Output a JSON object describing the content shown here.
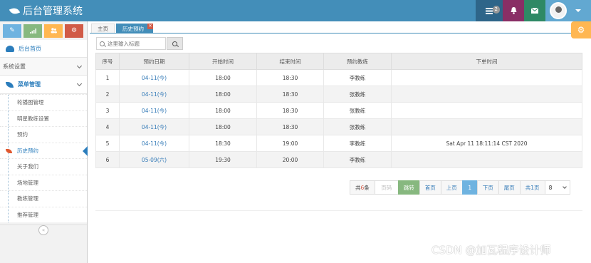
{
  "app": {
    "title": "后台管理系统"
  },
  "navbar": {
    "tasks_badge": "2"
  },
  "sidebar": {
    "home_label": "后台首页",
    "settings_label": "系统设置",
    "menu_label": "菜单管理",
    "items": [
      {
        "label": "轮播图管理",
        "active": false
      },
      {
        "label": "明星教练设置",
        "active": false
      },
      {
        "label": "预约",
        "active": false
      },
      {
        "label": "历史预约",
        "active": true
      },
      {
        "label": "关于我们",
        "active": false
      },
      {
        "label": "场地管理",
        "active": false
      },
      {
        "label": "教练管理",
        "active": false
      },
      {
        "label": "推荐管理",
        "active": false
      }
    ]
  },
  "tabs": [
    {
      "label": "主页",
      "active": false
    },
    {
      "label": "历史预约",
      "active": true
    }
  ],
  "search": {
    "placeholder": "这里输入标题"
  },
  "table": {
    "headers": [
      "序号",
      "预约日期",
      "开始时间",
      "结束时间",
      "预约教练",
      "下单时间"
    ],
    "rows": [
      [
        "1",
        "04-11(今)",
        "18:00",
        "18:30",
        "李教练",
        ""
      ],
      [
        "2",
        "04-11(今)",
        "18:00",
        "18:30",
        "张教练",
        ""
      ],
      [
        "3",
        "04-11(今)",
        "18:00",
        "18:30",
        "张教练",
        ""
      ],
      [
        "4",
        "04-11(今)",
        "18:00",
        "18:30",
        "张教练",
        ""
      ],
      [
        "5",
        "04-11(今)",
        "18:30",
        "19:00",
        "李教练",
        "Sat Apr 11 18:11:14 CST 2020"
      ],
      [
        "6",
        "05-09(六)",
        "19:30",
        "20:00",
        "李教练",
        ""
      ]
    ]
  },
  "pager": {
    "total_prefix": "共",
    "total_count": "6",
    "total_suffix": "条",
    "page_input_placeholder": "页码",
    "jump": "跳转",
    "first": "首页",
    "prev": "上页",
    "current": "1",
    "next": "下页",
    "last": "尾页",
    "page_total": "共1页",
    "page_size": "8"
  },
  "watermark": "CSDN @加瓦程序设计师",
  "colors": {
    "navbar": "#438eb9",
    "accent": "#2b7dbc",
    "jump": "#87b87f",
    "current_page": "#6fb3e0"
  }
}
